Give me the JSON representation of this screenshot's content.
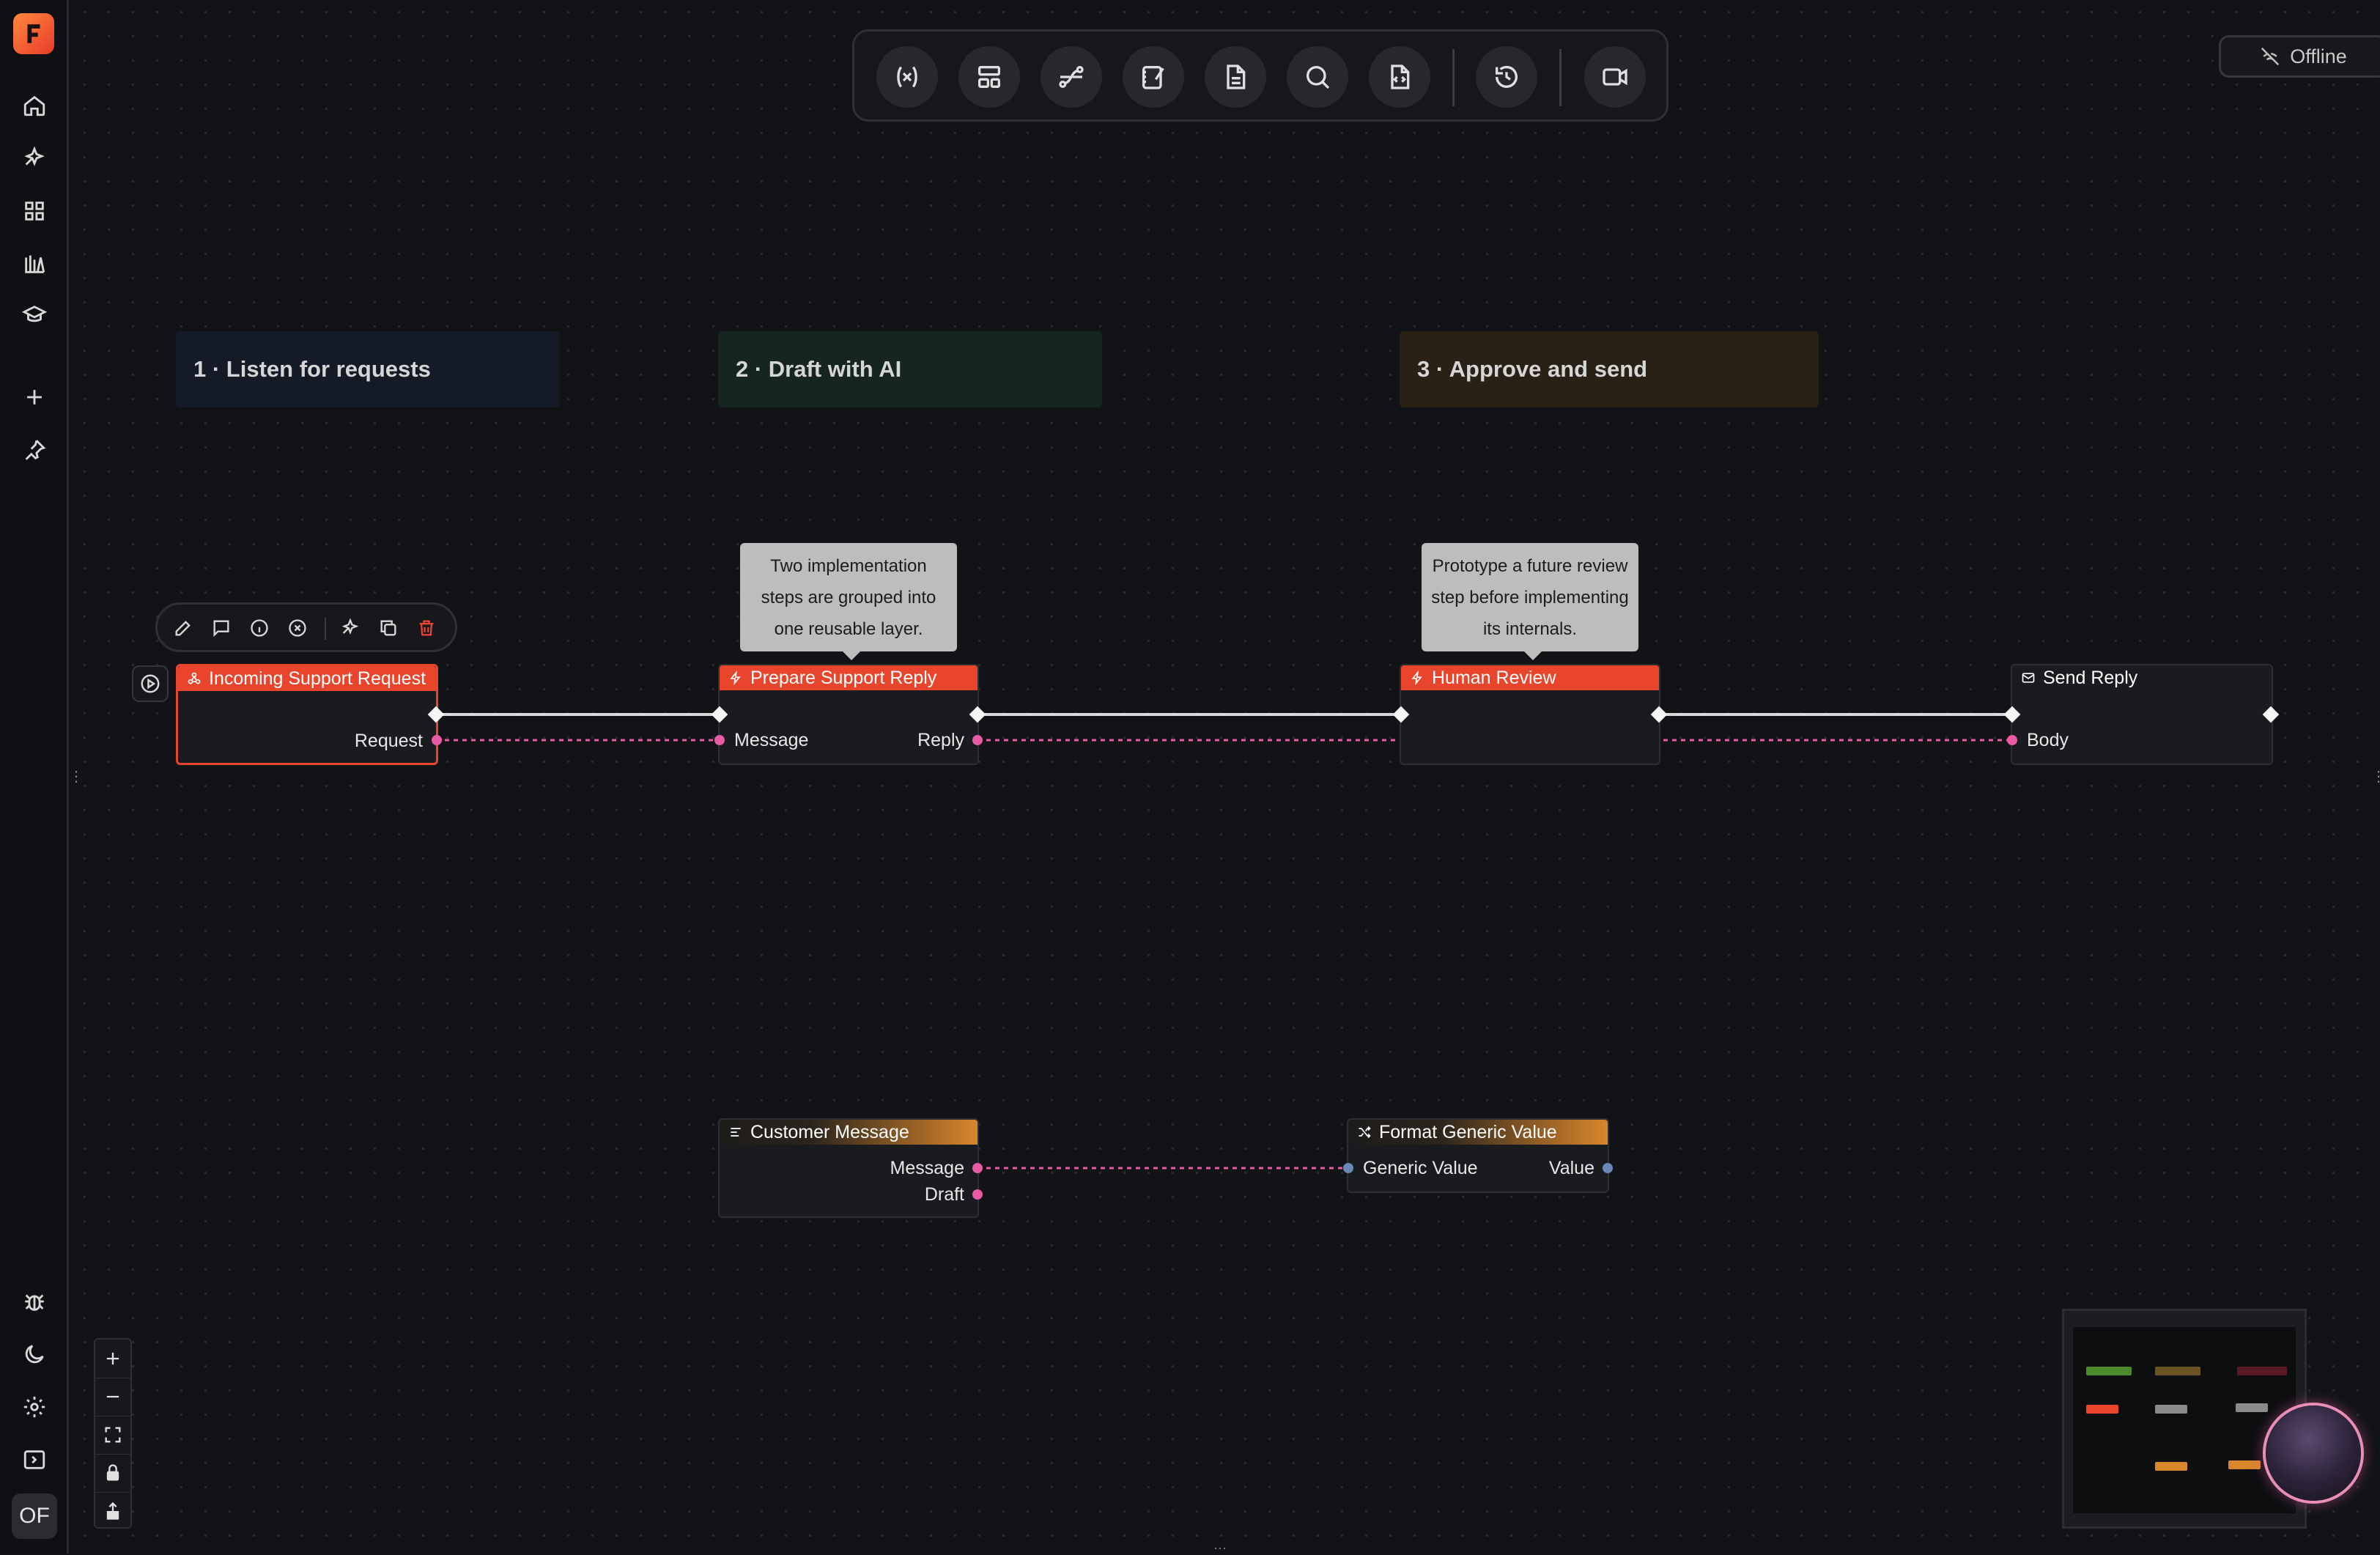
{
  "status": {
    "offline_label": "Offline"
  },
  "sidebar": {
    "avatar_initials": "OF"
  },
  "sections": [
    {
      "label": "1 · Listen for requests",
      "color": "#141b27"
    },
    {
      "label": "2 · Draft with AI",
      "color": "#162520"
    },
    {
      "label": "3 · Approve and send",
      "color": "#2a2116"
    }
  ],
  "notes": {
    "prepare": [
      "Two implementation",
      "steps are grouped into",
      "one reusable layer."
    ],
    "review": [
      "Prototype a future review",
      "step before implementing",
      "its internals."
    ]
  },
  "nodes": {
    "incoming": {
      "title": "Incoming Support Request",
      "output": "Request"
    },
    "prepare": {
      "title": "Prepare Support Reply",
      "input": "Message",
      "output": "Reply"
    },
    "review": {
      "title": "Human Review"
    },
    "send": {
      "title": "Send Reply",
      "input": "Body"
    },
    "customer": {
      "title": "Customer Message",
      "outputs": [
        "Message",
        "Draft"
      ]
    },
    "format": {
      "title": "Format Generic Value",
      "input": "Generic Value",
      "output": "Value"
    }
  },
  "colors": {
    "accent_red": "#e8452c",
    "accent_orange": "#d9862c",
    "pin_pink": "#ea5aa4",
    "pin_blue": "#6a88b8"
  }
}
